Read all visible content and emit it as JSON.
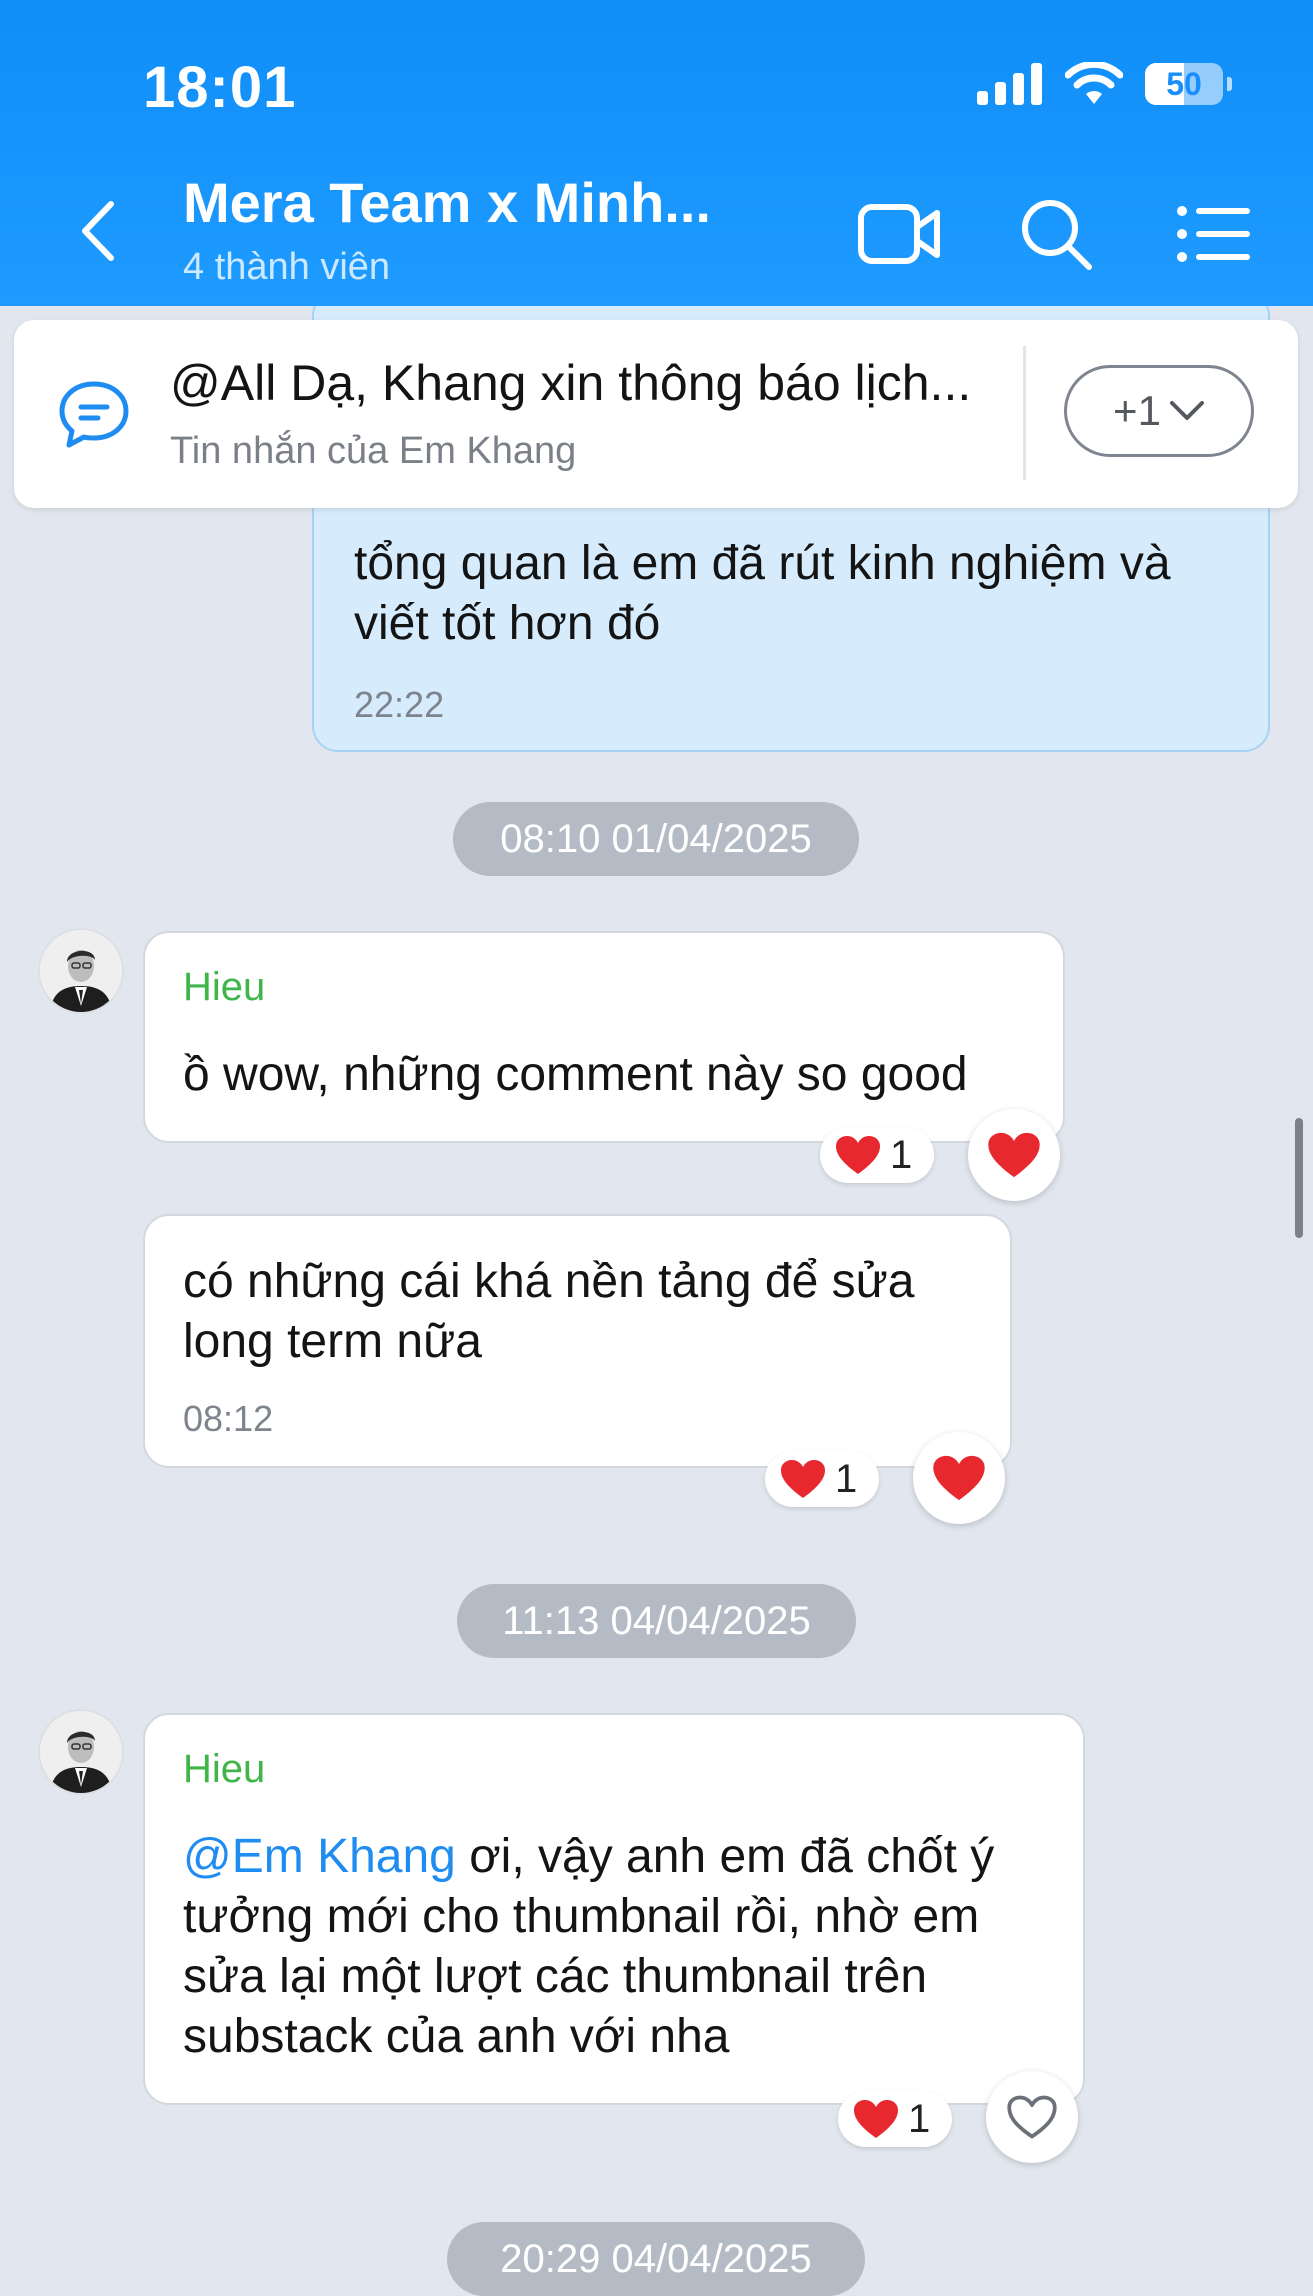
{
  "status_bar": {
    "time": "18:01",
    "battery": "50",
    "battery_level_percent": 50
  },
  "header": {
    "title": "Mera Team x Minh...",
    "subtitle": "4 thành viên",
    "icons": [
      "back-icon",
      "video-call-icon",
      "search-icon",
      "menu-list-icon"
    ]
  },
  "pinned": {
    "title": "@All Dạ, Khang xin thông báo lịch...",
    "subtitle": "Tin nhắn của Em Khang",
    "more_label": "+1"
  },
  "messages": {
    "outgoing_1": {
      "text": "tổng quan là em đã rút kinh nghiệm và viết tốt hơn đó",
      "time": "22:22"
    },
    "date_1": "08:10 01/04/2025",
    "in_1": {
      "sender": "Hieu",
      "text": "ồ wow, những comment này so good",
      "reaction_count": "1"
    },
    "in_2": {
      "text": "có những cái khá nền tảng để sửa long term nữa",
      "time": "08:12",
      "reaction_count": "1"
    },
    "date_2": "11:13 04/04/2025",
    "in_3": {
      "sender": "Hieu",
      "mention": "@Em Khang",
      "text": " ơi, vậy anh em đã chốt ý tưởng mới cho thumbnail rồi, nhờ em sửa lại một lượt các thumbnail trên substack của anh với nha",
      "reaction_count": "1"
    },
    "date_3": "20:29 04/04/2025"
  },
  "colors": {
    "header_blue": "#1a93fb",
    "sender_green": "#3fb54a",
    "mention_blue": "#1f8cf2",
    "outgoing_bubble": "#d6ecfd"
  }
}
